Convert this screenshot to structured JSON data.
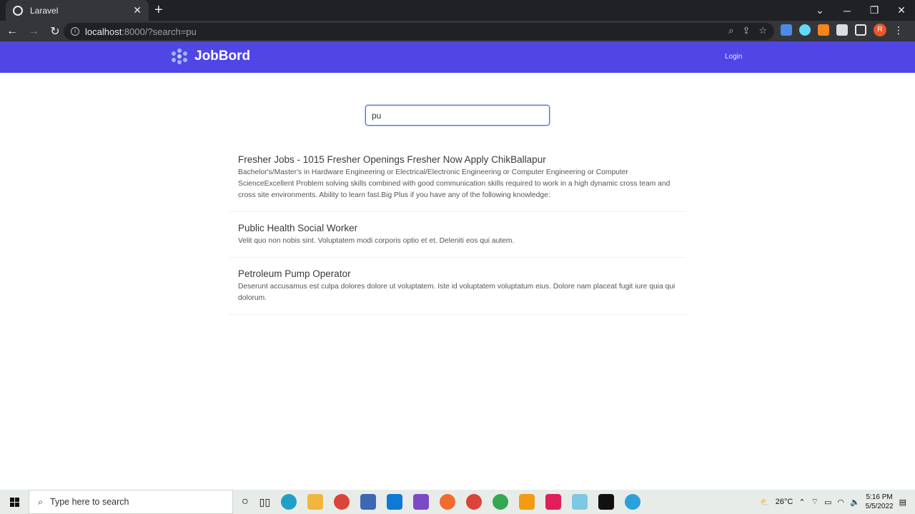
{
  "browser": {
    "tab_title": "Laravel",
    "tab_close": "✕",
    "new_tab": "+",
    "url_host": "localhost",
    "url_path": ":8000/?search=pu",
    "avatar_letter": "R"
  },
  "navbar": {
    "brand": "JobBord",
    "login": "Login",
    "brand_color": "#4f46e5"
  },
  "search": {
    "value": "pu"
  },
  "jobs": [
    {
      "title": "Fresher Jobs - 1015 Fresher Openings Fresher Now Apply ChikBallapur",
      "description": "Bachelor's/Master's in Hardware Engineering or Electrical/Electronic Engineering or Computer Engineering or Computer ScienceExcellent Problem solving skills combined with good communication skills required to work in a high dynamic cross team and cross site environments. Ability to learn fast.Big Plus if you have any of the following knowledge:"
    },
    {
      "title": "Public Health Social Worker",
      "description": "Velit quo non nobis sint. Voluptatem modi corporis optio et et. Deleniti eos qui autem."
    },
    {
      "title": "Petroleum Pump Operator",
      "description": "Deserunt accusamus est culpa dolores dolore ut voluptatem. Iste id voluptatem voluptatum eius. Dolore nam placeat fugit iure quia qui dolorum."
    }
  ],
  "taskbar": {
    "search_placeholder": "Type here to search",
    "temperature": "26°C",
    "time": "5:16 PM",
    "date": "5/5/2022"
  }
}
